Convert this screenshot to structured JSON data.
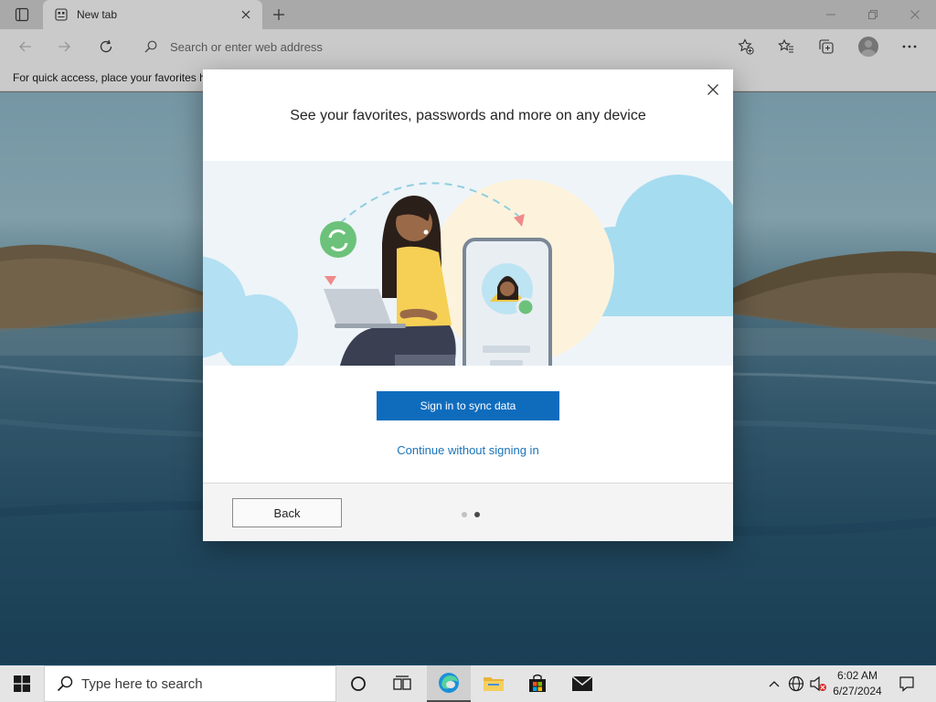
{
  "browser": {
    "tab": {
      "title": "New tab"
    },
    "address": {
      "placeholder": "Search or enter web address"
    },
    "favorites_bar": {
      "text": "For quick access, place your favorites h"
    }
  },
  "dialog": {
    "title": "See your favorites, passwords and more on any device",
    "primary_button": "Sign in to sync data",
    "secondary_link": "Continue without signing in",
    "back_button": "Back",
    "pagination": {
      "total": 2,
      "current": 2
    }
  },
  "taskbar": {
    "search_placeholder": "Type here to search",
    "clock": {
      "time": "6:02 AM",
      "date": "6/27/2024"
    },
    "apps": [
      "cortana-icon",
      "task-view-icon",
      "edge-icon",
      "file-explorer-icon",
      "store-icon",
      "mail-icon"
    ]
  },
  "colors": {
    "accent": "#0f6cbd",
    "link": "#1a73b8"
  }
}
